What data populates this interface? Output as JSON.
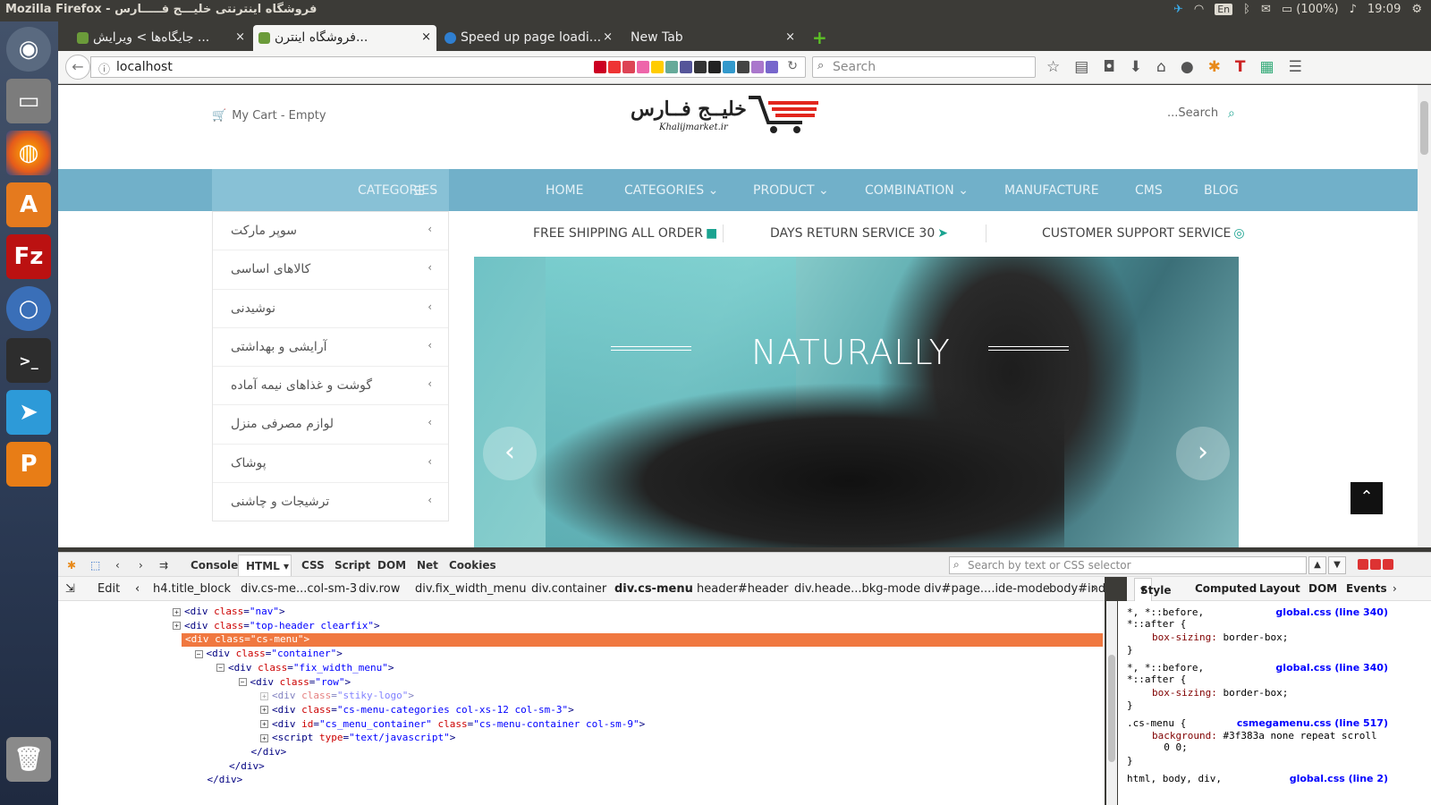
{
  "os": {
    "window_title": "Mozilla Firefox - فروشگاه اینترنتی خلیـــج فـــــارس",
    "keyboard": "En",
    "battery": "(100%)",
    "clock": "19:09"
  },
  "tabs": [
    {
      "label": "جایگاه‌ها > ویرایش ...",
      "close": "×"
    },
    {
      "label": "فروشگاه اینترن...",
      "close": "×"
    },
    {
      "label": "Speed up page loadi...",
      "close": "×"
    },
    {
      "label": "New Tab",
      "close": "×"
    }
  ],
  "new_tab_symbol": "+",
  "urlbar": {
    "value": "localhost"
  },
  "browser_search": {
    "placeholder": "Search"
  },
  "site": {
    "cart": "My Cart - Empty",
    "logo_text": "خلیــج فــارس",
    "logo_sub": "Khalijmarket.ir",
    "search_placeholder": "...Search",
    "categories_button": "CATEGORIES",
    "menu": [
      "HOME",
      "CATEGORIES",
      "PRODUCT",
      "COMBINATION",
      "MANUFACTURE",
      "CMS",
      "BLOG"
    ],
    "side_categories": [
      "سوپر مارکت",
      "کالاهای اساسی",
      "نوشیدنی",
      "آرایشی و بهداشتی",
      "گوشت و غذاهای نیمه آماده",
      "لوازم مصرفی منزل",
      "پوشاک",
      "ترشیجات و چاشنی"
    ],
    "services": [
      "FREE SHIPPING ALL ORDER",
      "DAYS RETURN SERVICE 30",
      "CUSTOMER SUPPORT SERVICE"
    ],
    "banner_word": "NATURALLY"
  },
  "devtools": {
    "tabs": [
      "Console",
      "HTML",
      "CSS",
      "Script",
      "DOM",
      "Net",
      "Cookies"
    ],
    "search_placeholder": "Search by text or CSS selector",
    "edit": "Edit",
    "breadcrumbs": [
      "h4.title_block",
      "div.cs-me...col-sm-3",
      "div.row",
      "div.fix_width_menu",
      "div.container",
      "div.cs-menu",
      "header#header",
      "div.heade...bkg-mode",
      "div#page....ide-mode",
      "body#ind"
    ],
    "side_tabs": [
      "Style",
      "Computed",
      "Layout",
      "DOM",
      "Events"
    ],
    "html_lines": [
      {
        "indent": 0,
        "tag": "div",
        "attr": "class",
        "val": "nav",
        "close": ">",
        "toggle": "+"
      },
      {
        "indent": 0,
        "tag": "div",
        "attr": "class",
        "val": "top-header clearfix",
        "close": ">",
        "toggle": "+"
      },
      {
        "indent": 0,
        "tag": "div",
        "attr": "class",
        "val": "cs-menu",
        "close": ">",
        "toggle": "−",
        "selected": true
      },
      {
        "indent": 1,
        "tag": "div",
        "attr": "class",
        "val": "container",
        "close": ">",
        "toggle": "−"
      },
      {
        "indent": 2,
        "tag": "div",
        "attr": "class",
        "val": "fix_width_menu",
        "close": ">",
        "toggle": "−"
      },
      {
        "indent": 3,
        "tag": "div",
        "attr": "class",
        "val": "row",
        "close": ">",
        "toggle": "−"
      },
      {
        "indent": 4,
        "tag": "div",
        "attr": "class",
        "val": "stiky-logo",
        "close": ">",
        "toggle": "+",
        "dim": true
      },
      {
        "indent": 4,
        "tag": "div",
        "attr": "class",
        "val": "cs-menu-categories col-xs-12 col-sm-3",
        "close": ">",
        "toggle": "+"
      },
      {
        "indent": 4,
        "tag": "div",
        "attr": "id",
        "val": "cs_menu_container",
        "attr2": "class",
        "val2": "cs-menu-container col-sm-9",
        "close": ">",
        "toggle": "+"
      },
      {
        "indent": 4,
        "tag": "script",
        "attr": "type",
        "val": "text/javascript",
        "close": ">",
        "toggle": "+"
      },
      {
        "indent": 3,
        "end": "</div>"
      },
      {
        "indent": 2,
        "end": "</div>"
      },
      {
        "indent": 1,
        "end": "</div>"
      }
    ],
    "style_rules": [
      {
        "selector": "*, *::before,\n*::after {",
        "source": "global.css (line 340)",
        "prop": "box-sizing",
        "value": "border-box;"
      },
      {
        "selector": "*, *::before,\n*::after {",
        "source": "global.css (line 340)",
        "prop": "box-sizing",
        "value": "border-box;"
      },
      {
        "selector": ".cs-menu {",
        "source": "csmegamenu.css (line 517)",
        "prop": "background",
        "value": "#3f383a none repeat scroll\n  0 0;"
      },
      {
        "selector": "html, body, div,",
        "source": "global.css (line 2)"
      }
    ]
  },
  "colors": {
    "accent": "#1aa390",
    "menu_bg": "#71b0c9",
    "selected_node": "#f07840"
  }
}
